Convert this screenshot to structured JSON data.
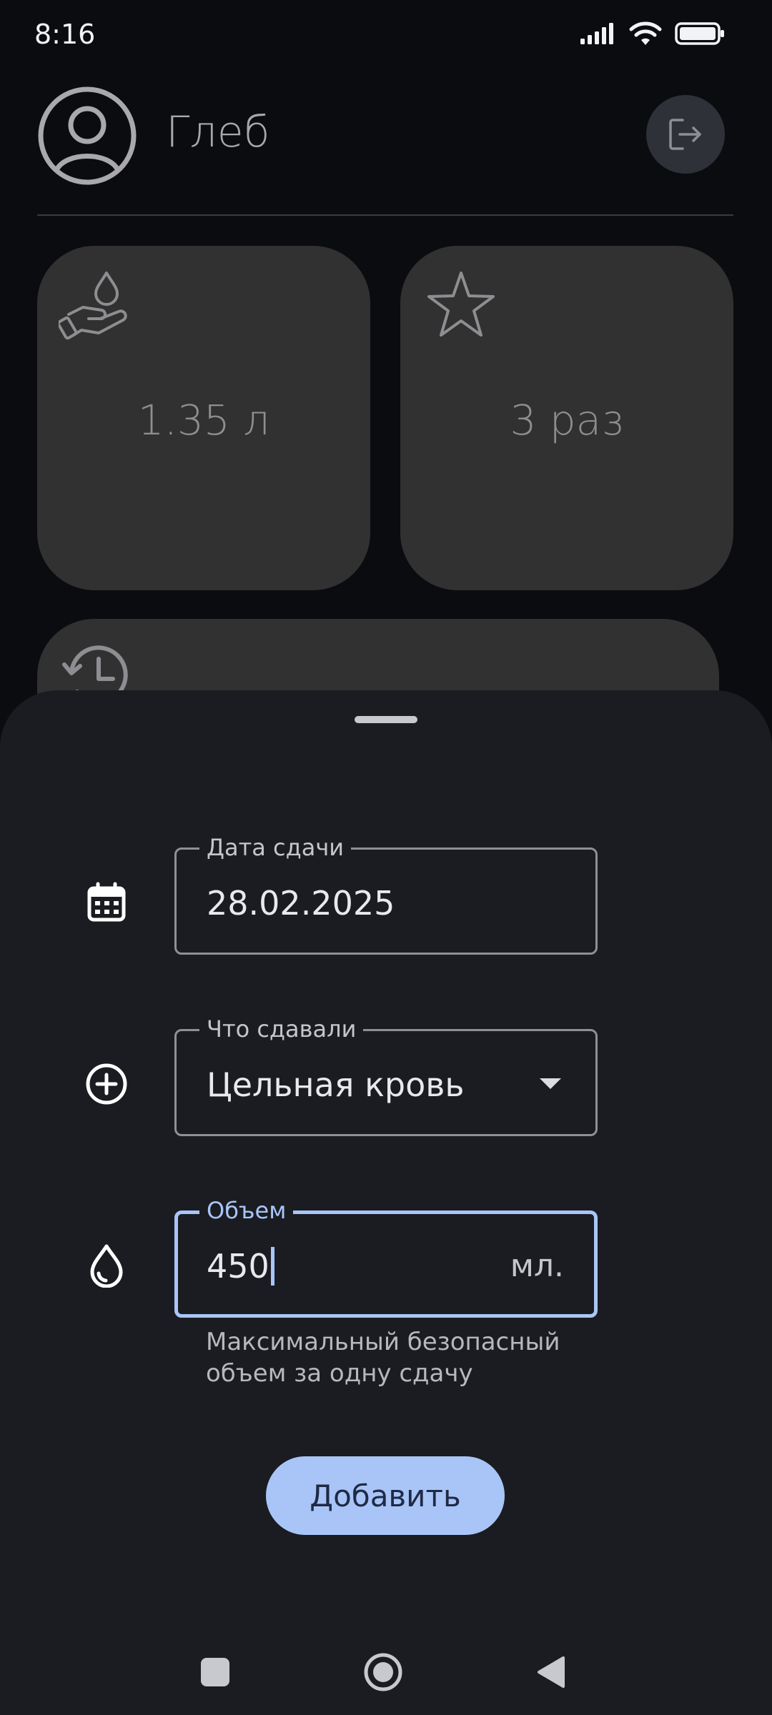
{
  "status_bar": {
    "time": "8:16",
    "icons": [
      "signal-icon",
      "wifi-icon",
      "battery-icon"
    ]
  },
  "header": {
    "user_name": "Глеб",
    "avatar_icon": "account-circle-icon",
    "logout_icon": "logout-icon"
  },
  "stats": {
    "volume": {
      "icon": "hand-drop-icon",
      "value": "1.35 л"
    },
    "count": {
      "icon": "star-icon",
      "value": "3 раз"
    },
    "history": {
      "icon": "history-icon"
    }
  },
  "sheet": {
    "date_field": {
      "icon": "calendar-icon",
      "label": "Дата сдачи",
      "value": "28.02.2025"
    },
    "type_field": {
      "icon": "add-circle-icon",
      "label": "Что сдавали",
      "value": "Цельная кровь"
    },
    "volume_field": {
      "icon": "drop-icon",
      "label": "Объем",
      "value": "450",
      "suffix": "мл.",
      "supporting_text": "Максимальный безопасный объем за одну сдачу"
    },
    "add_button_label": "Добавить"
  },
  "nav_bar": {
    "buttons": [
      "recents-icon",
      "home-icon",
      "back-icon"
    ]
  },
  "colors": {
    "background": "#0b0c10",
    "sheet": "#1b1c21",
    "card": "#313131",
    "accent": "#a9c5f8"
  }
}
